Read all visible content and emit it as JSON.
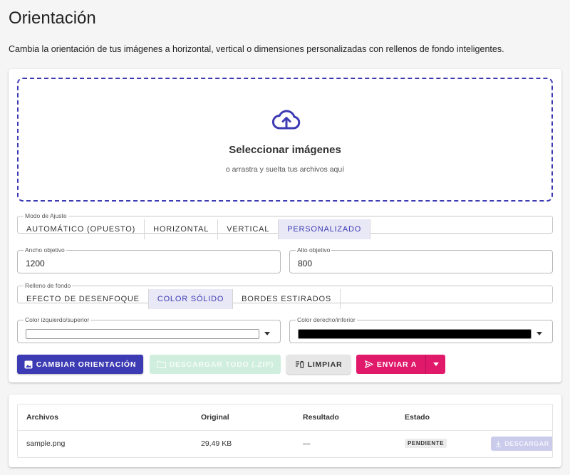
{
  "page": {
    "title": "Orientación",
    "description": "Cambia la orientación de tus imágenes a horizontal, vertical o dimensiones personalizadas con rellenos de fondo inteligentes."
  },
  "dropzone": {
    "title": "Seleccionar imágenes",
    "subtitle": "o arrastra y suelta tus archivos aquí",
    "icon": "cloud-upload-icon"
  },
  "fit_mode": {
    "label": "Modo de Ajuste",
    "options": [
      "AUTOMÁTICO (OPUESTO)",
      "HORIZONTAL",
      "VERTICAL",
      "PERSONALIZADO"
    ],
    "selected": "PERSONALIZADO"
  },
  "target": {
    "width_label": "Ancho objetivo",
    "width_value": "1200",
    "height_label": "Alto objetivo",
    "height_value": "800"
  },
  "fill": {
    "label": "Relleno de fondo",
    "options": [
      "EFECTO DE DESENFOQUE",
      "COLOR SÓLIDO",
      "BORDES ESTIRADOS"
    ],
    "selected": "COLOR SÓLIDO"
  },
  "colors": {
    "left_label": "Color izquierdo/superior",
    "left_color": "#ffffff",
    "right_label": "Color derecho/inferior",
    "right_color": "#000000"
  },
  "actions": {
    "rotate_label": "CAMBIAR ORIENTACIÓN",
    "zip_label": "DESCARGAR TODO (.ZIP)",
    "clear_label": "LIMPIAR",
    "send_label": "ENVIAR A"
  },
  "table": {
    "headers": [
      "Archivos",
      "Original",
      "Resultado",
      "Estado"
    ],
    "rows": [
      {
        "file": "sample.png",
        "original": "29,49 KB",
        "result": "—",
        "status": "PENDIENTE",
        "download": "DESCARGAR"
      }
    ]
  },
  "theme": {
    "primary": "#3d3bb3",
    "accent": "#e0196b",
    "success_disabled": "#cfeedd"
  }
}
